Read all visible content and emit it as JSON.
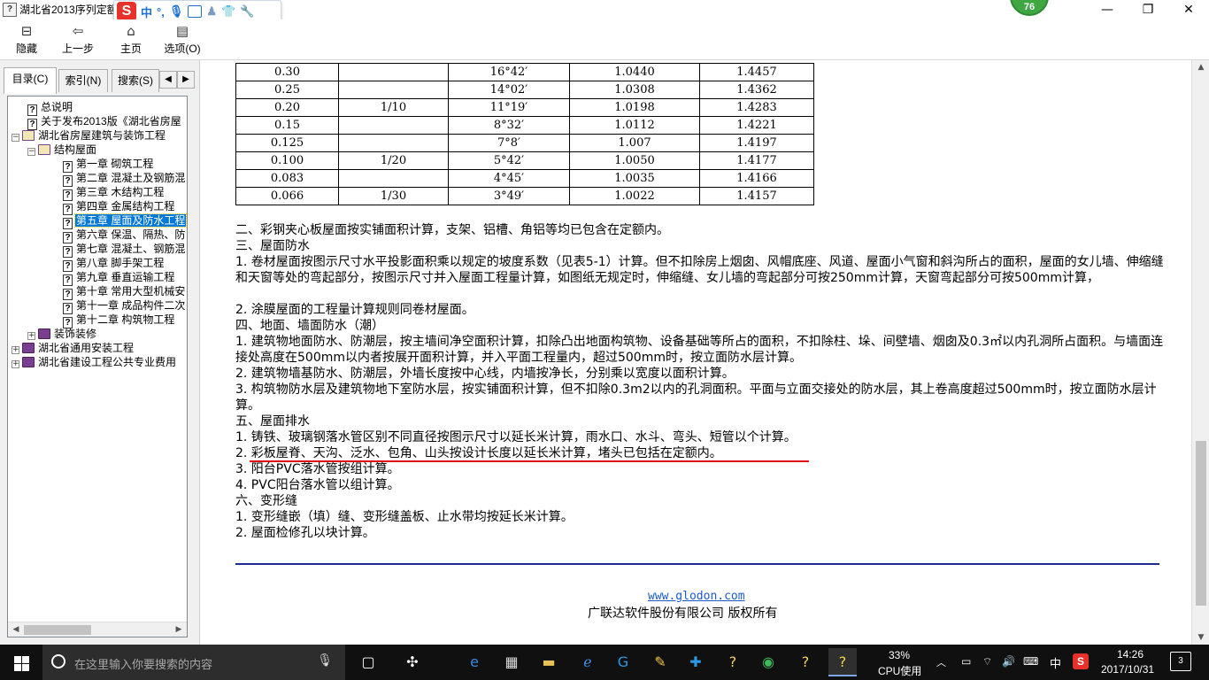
{
  "window": {
    "title": "湖北省2013序列定额",
    "badge": "76",
    "controls": [
      "—",
      "❐",
      "✕"
    ]
  },
  "ime": {
    "logo": "S",
    "mode": "中",
    "punct": "°,"
  },
  "toolbar": {
    "buttons": [
      {
        "label": "隐藏",
        "icon": "hide-icon"
      },
      {
        "label": "上一步",
        "icon": "back-arrow-icon"
      },
      {
        "label": "主页",
        "icon": "home-icon"
      },
      {
        "label": "选项(O)",
        "icon": "options-icon"
      }
    ]
  },
  "sidebar": {
    "tabs": [
      "目录(C)",
      "索引(N)",
      "搜索(S)"
    ],
    "tree": [
      {
        "label": "总说明",
        "icon": "help-page-icon",
        "level": 1
      },
      {
        "label": "关于发布2013版《湖北省房屋",
        "icon": "help-page-icon",
        "level": 1
      },
      {
        "label": "湖北省房屋建筑与装饰工程",
        "icon": "open-book-icon",
        "level": 0,
        "expander": "−"
      },
      {
        "label": "结构屋面",
        "icon": "open-book-icon",
        "level": 1,
        "expander": "−"
      },
      {
        "label": "第一章 砌筑工程",
        "icon": "help-page-icon",
        "level": 2
      },
      {
        "label": "第二章 混凝土及钢筋混",
        "icon": "help-page-icon",
        "level": 2
      },
      {
        "label": "第三章 木结构工程",
        "icon": "help-page-icon",
        "level": 2
      },
      {
        "label": "第四章 金属结构工程",
        "icon": "help-page-icon",
        "level": 2
      },
      {
        "label": "第五章 屋面及防水工程",
        "icon": "help-page-icon",
        "level": 2,
        "selected": true
      },
      {
        "label": "第六章 保温、隔热、防",
        "icon": "help-page-icon",
        "level": 2
      },
      {
        "label": "第七章 混凝土、钢筋混",
        "icon": "help-page-icon",
        "level": 2
      },
      {
        "label": "第八章 脚手架工程",
        "icon": "help-page-icon",
        "level": 2
      },
      {
        "label": "第九章 垂直运输工程",
        "icon": "help-page-icon",
        "level": 2
      },
      {
        "label": "第十章 常用大型机械安",
        "icon": "help-page-icon",
        "level": 2
      },
      {
        "label": "第十一章 成品构件二次",
        "icon": "help-page-icon",
        "level": 2
      },
      {
        "label": "第十二章 构筑物工程",
        "icon": "help-page-icon",
        "level": 2
      },
      {
        "label": "装饰装修",
        "icon": "closed-book-icon",
        "level": 1,
        "expander": "+"
      },
      {
        "label": "湖北省通用安装工程",
        "icon": "closed-book-icon",
        "level": 0,
        "expander": "+"
      },
      {
        "label": "湖北省建设工程公共专业费用",
        "icon": "closed-book-icon",
        "level": 0,
        "expander": "+"
      }
    ]
  },
  "table": {
    "rows": [
      [
        "0.30",
        "",
        "16°42′",
        "1.0440",
        "1.4457"
      ],
      [
        "0.25",
        "",
        "14°02′",
        "1.0308",
        "1.4362"
      ],
      [
        "0.20",
        "1/10",
        "11°19′",
        "1.0198",
        "1.4283"
      ],
      [
        "0.15",
        "",
        "8°32′",
        "1.0112",
        "1.4221"
      ],
      [
        "0.125",
        "",
        "7°8′",
        "1.007",
        "1.4197"
      ],
      [
        "0.100",
        "1/20",
        "5°42′",
        "1.0050",
        "1.4177"
      ],
      [
        "0.083",
        "",
        "4°45′",
        "1.0035",
        "1.4166"
      ],
      [
        "0.066",
        "1/30",
        "3°49′",
        "1.0022",
        "1.4157"
      ]
    ]
  },
  "content": {
    "paragraphs": [
      "二、彩钢夹心板屋面按实铺面积计算，支架、铝槽、角铝等均已包含在定额内。",
      "三、屋面防水",
      "1. 卷材屋面按图示尺寸水平投影面积乘以规定的坡度系数（见表5-1）计算。但不扣除房上烟囱、风帽底座、风道、屋面小气窗和斜沟所占的面积，屋面的女儿墙、伸缩缝和天窗等处的弯起部分，按图示尺寸并入屋面工程量计算，如图纸无规定时，伸缩缝、女儿墙的弯起部分可按250mm计算，天窗弯起部分可按500mm计算，",
      "2. 涂膜屋面的工程量计算规则同卷材屋面。",
      "四、地面、墙面防水（潮）",
      "1. 建筑物地面防水、防潮层，按主墙间净空面积计算，扣除凸出地面构筑物、设备基础等所占的面积，不扣除柱、垛、间壁墙、烟囱及0.3㎡以内孔洞所占面积。与墙面连接处高度在500mm以内者按展开面积计算，并入平面工程量内，超过500mm时，按立面防水层计算。",
      "2. 建筑物墙基防水、防潮层，外墙长度按中心线，内墙按净长，分别乘以宽度以面积计算。",
      "3. 构筑物防水层及建筑物地下室防水层，按实铺面积计算，但不扣除0.3m2以内的孔洞面积。平面与立面交接处的防水层，其上卷高度超过500mm时，按立面防水层计算。",
      "五、屋面排水",
      "1. 铸铁、玻璃钢落水管区别不同直径按图示尺寸以延长米计算，雨水口、水斗、弯头、短管以个计算。",
      "2. 彩板屋脊、天沟、泛水、包角、山头按设计长度以延长米计算，堵头已包括在定额内。",
      "3. 阳台PVC落水管按组计算。",
      "4. PVC阳台落水管以组计算。",
      "六、变形缝",
      "1. 变形缝嵌（填）缝、变形缝盖板、止水带均按延长米计算。",
      "2. 屋面检修孔以块计算。"
    ],
    "footer_link": "www.glodon.com",
    "footer_copyright": "广联达软件股份有限公司 版权所有"
  },
  "taskbar": {
    "search_placeholder": "在这里输入你要搜索的内容",
    "cpu_percent": "33%",
    "cpu_label": "CPU使用",
    "ime": "中",
    "time": "14:26",
    "date": "2017/10/31",
    "notifications": "3",
    "apps": [
      "task-view-icon",
      "fan-icon",
      "edge-icon",
      "store-icon",
      "folder-icon",
      "ie-icon",
      "glodon-g-icon",
      "sticky-note-icon",
      "plus-app-icon",
      "help-app-icon",
      "green-app-icon",
      "help-app-icon",
      "help-app-icon"
    ],
    "accent": "#7aa7e6"
  }
}
